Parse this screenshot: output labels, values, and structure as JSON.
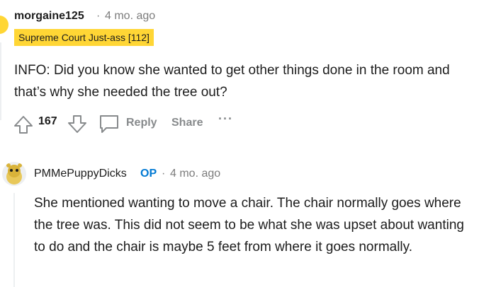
{
  "comment": {
    "username": "morgaine125",
    "separator": "·",
    "time": "4 mo. ago",
    "flair": "Supreme Court Just-ass [112]",
    "body": "INFO: Did you know she wanted to get other things done in the room and that’s why she needed the tree out?",
    "score": "167",
    "reply_label": "Reply",
    "share_label": "Share",
    "more_label": "···"
  },
  "reply": {
    "username": "PMMePuppyDicks",
    "op_badge": "OP",
    "separator": "·",
    "time": "4 mo. ago",
    "body": "She mentioned wanting to move a chair. The chair normally goes where the tree was. This did not seem to be what she was upset about wanting to do and the chair is maybe 5 feet from where it goes normally."
  },
  "colors": {
    "flair_bg": "#ffd635",
    "op_blue": "#0079d3",
    "meta_gray": "#7c7c7c",
    "action_gray": "#878a8c"
  },
  "icons": {
    "upvote": "upvote-arrow-icon",
    "downvote": "downvote-arrow-icon",
    "reply": "speech-bubble-icon",
    "avatar": "snoo-avatar-icon"
  }
}
